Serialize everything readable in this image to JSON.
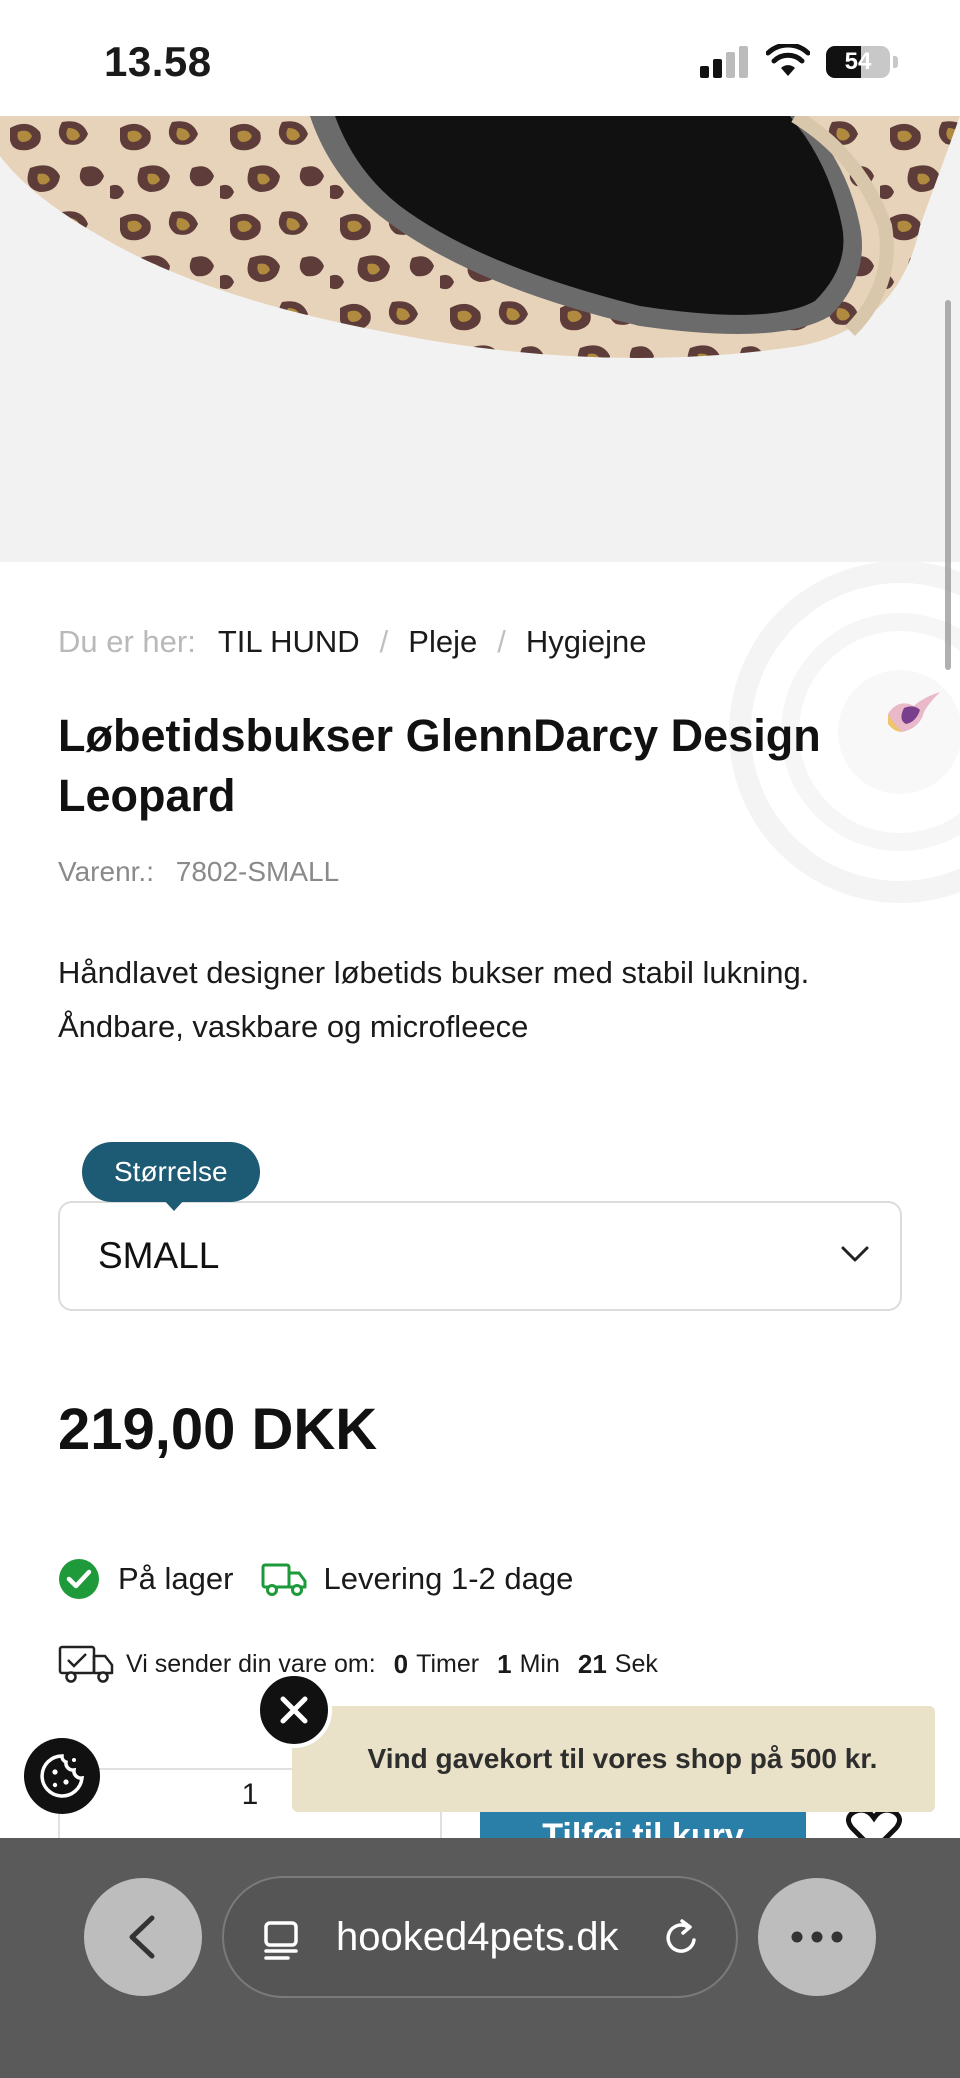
{
  "status_bar": {
    "time": "13.58",
    "battery_level": "54"
  },
  "product_image": {
    "carousel_total": 7,
    "carousel_active_index": 0
  },
  "breadcrumb": {
    "prefix": "Du er her:",
    "items": [
      "TIL HUND",
      "Pleje",
      "Hygiejne"
    ],
    "separator": "/"
  },
  "product": {
    "title": "Løbetidsbukser GlennDarcy Design Leopard",
    "sku_label": "Varenr.:",
    "sku_value": "7802-SMALL",
    "description_line1": "Håndlavet designer løbetids bukser med stabil lukning.",
    "description_line2": "Åndbare, vaskbare og microfleece",
    "price": "219,00 DKK"
  },
  "size_selector": {
    "label": "Størrelse",
    "selected": "SMALL"
  },
  "availability": {
    "stock": "På lager",
    "delivery": "Levering 1-2 dage"
  },
  "shipping_countdown": {
    "label": "Vi sender din vare om:",
    "hours": "0",
    "hours_unit": "Timer",
    "minutes": "1",
    "minutes_unit": "Min",
    "seconds": "21",
    "seconds_unit": "Sek"
  },
  "purchase": {
    "quantity": "1",
    "cart_button": "Tilføj til kurv"
  },
  "promo_banner": {
    "text": "Vind gavekort til vores shop på 500 kr."
  },
  "browser": {
    "url": "hooked4pets.dk"
  },
  "colors": {
    "accent_teal": "#1d5a73",
    "cart_blue": "#2a7fa8",
    "stock_green": "#1e9a3b",
    "promo_bg": "#e9e2c8",
    "browser_bar": "#5a5a5a"
  }
}
